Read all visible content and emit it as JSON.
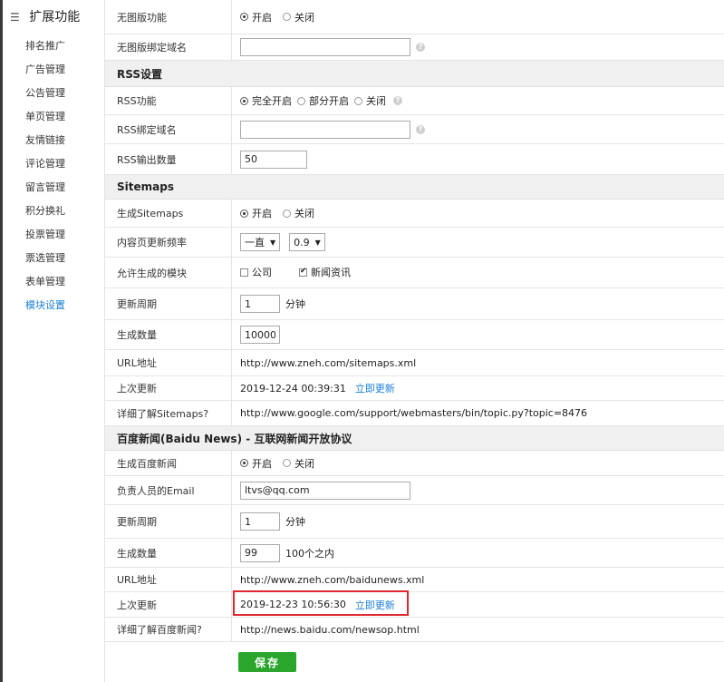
{
  "sidebar": {
    "title": "扩展功能",
    "items": [
      {
        "label": "排名推广"
      },
      {
        "label": "广告管理"
      },
      {
        "label": "公告管理"
      },
      {
        "label": "单页管理"
      },
      {
        "label": "友情链接"
      },
      {
        "label": "评论管理"
      },
      {
        "label": "留言管理"
      },
      {
        "label": "积分换礼"
      },
      {
        "label": "投票管理"
      },
      {
        "label": "票选管理"
      },
      {
        "label": "表单管理"
      },
      {
        "label": "模块设置"
      }
    ]
  },
  "nopic": {
    "feature_label": "无图版功能",
    "opt_on": "开启",
    "opt_off": "关闭",
    "domain_label": "无图版绑定域名",
    "domain_value": ""
  },
  "rss": {
    "section_title": "RSS设置",
    "feature_label": "RSS功能",
    "opt_full": "完全开启",
    "opt_partial": "部分开启",
    "opt_off": "关闭",
    "domain_label": "RSS绑定域名",
    "domain_value": "",
    "count_label": "RSS输出数量",
    "count_value": "50"
  },
  "sitemaps": {
    "section_title": "Sitemaps",
    "generate_label": "生成Sitemaps",
    "opt_on": "开启",
    "opt_off": "关闭",
    "freq_label": "内容页更新频率",
    "freq_value": "一直",
    "priority_value": "0.9",
    "modules_label": "允许生成的模块",
    "module_company": "公司",
    "module_news": "新闻资讯",
    "period_label": "更新周期",
    "period_value": "1",
    "period_unit": "分钟",
    "count_label": "生成数量",
    "count_value": "10000",
    "url_label": "URL地址",
    "url_value": "http://www.zneh.com/sitemaps.xml",
    "last_label": "上次更新",
    "last_value": "2019-12-24 00:39:31",
    "update_link": "立即更新",
    "more_label": "详细了解Sitemaps?",
    "more_value": "http://www.google.com/support/webmasters/bin/topic.py?topic=8476"
  },
  "baidu": {
    "section_title": "百度新闻(Baidu News) - 互联网新闻开放协议",
    "generate_label": "生成百度新闻",
    "opt_on": "开启",
    "opt_off": "关闭",
    "email_label": "负责人员的Email",
    "email_value": "ltvs@qq.com",
    "period_label": "更新周期",
    "period_value": "1",
    "period_unit": "分钟",
    "count_label": "生成数量",
    "count_value": "99",
    "count_unit": "100个之内",
    "url_label": "URL地址",
    "url_value": "http://www.zneh.com/baidunews.xml",
    "last_label": "上次更新",
    "last_value": "2019-12-23 10:56:30",
    "update_link": "立即更新",
    "more_label": "详细了解百度新闻?",
    "more_value": "http://news.baidu.com/newsop.html"
  },
  "save_label": "保存",
  "colors": {
    "link": "#1a7fd6",
    "save_button": "#2aa62d",
    "highlight_border": "#e0262e",
    "section_bg": "#f0f0f0"
  }
}
